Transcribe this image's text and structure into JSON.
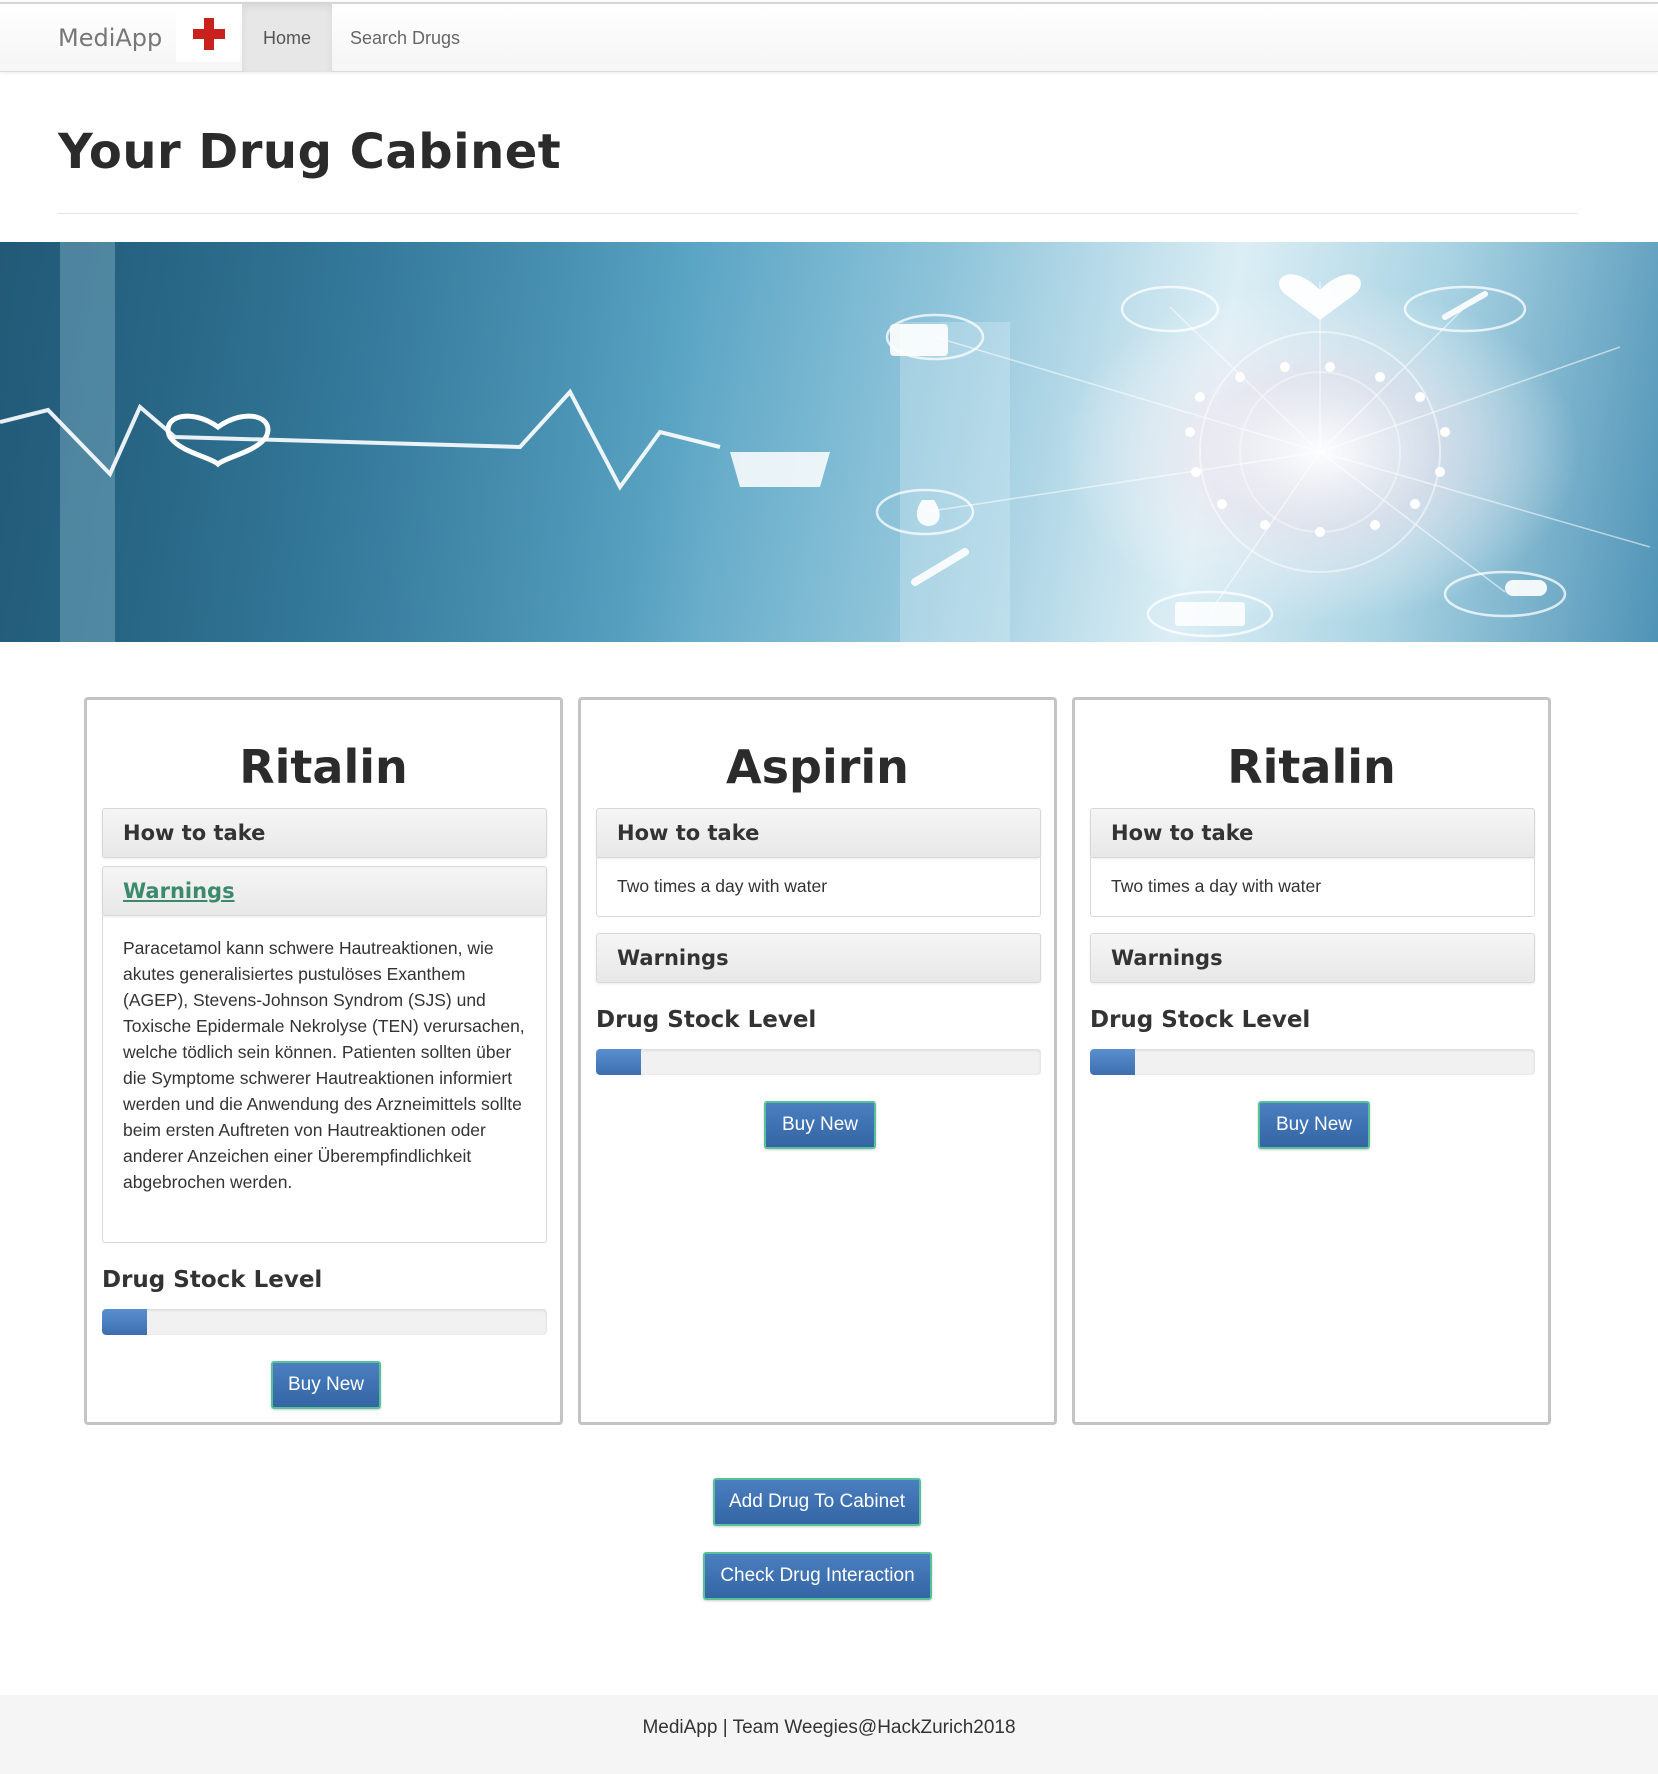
{
  "navbar": {
    "brand": "MediApp",
    "items": [
      {
        "label": "Home",
        "active": true
      },
      {
        "label": "Search Drugs",
        "active": false
      }
    ]
  },
  "page": {
    "title": "Your Drug Cabinet"
  },
  "cards": [
    {
      "name": "Ritalin",
      "how_to_take_label": "How to take",
      "how_to_take_text": "",
      "how_to_take_expanded": false,
      "warnings_label": "Warnings",
      "warnings_expanded": true,
      "warnings_text": "Paracetamol kann schwere Hautreaktionen, wie akutes generalisiertes pustulöses Exanthem (AGEP), Stevens-Johnson Syndrom (SJS) und Toxische Epidermale Nekrolyse (TEN) verursachen, welche tödlich sein können. Patienten sollten über die Symptome schwerer Hautreaktionen informiert werden und die Anwendung des Arzneimittels sollte beim ersten Auftreten von Hautreaktionen oder anderer Anzeichen einer Überempfindlichkeit abgebrochen werden.",
      "stock_label": "Drug Stock Level",
      "stock_level": 0.1,
      "buy_label": "Buy New"
    },
    {
      "name": "Aspirin",
      "how_to_take_label": "How to take",
      "how_to_take_text": "Two times a day with water",
      "how_to_take_expanded": true,
      "warnings_label": "Warnings",
      "warnings_expanded": false,
      "warnings_text": "",
      "stock_label": "Drug Stock Level",
      "stock_level": 0.1,
      "buy_label": "Buy New"
    },
    {
      "name": "Ritalin",
      "how_to_take_label": "How to take",
      "how_to_take_text": "Two times a day with water",
      "how_to_take_expanded": true,
      "warnings_label": "Warnings",
      "warnings_expanded": false,
      "warnings_text": "",
      "stock_label": "Drug Stock Level",
      "stock_level": 0.1,
      "buy_label": "Buy New"
    }
  ],
  "actions": {
    "add_drug": "Add Drug To Cabinet",
    "check_interaction": "Check Drug Interaction"
  },
  "footer": {
    "text": "MediApp | Team Weegies@HackZurich2018"
  },
  "colors": {
    "brand_cross": "#c9211e",
    "button_bg": "#3d72b4",
    "button_border": "#57c29a",
    "progress_fill": "#4a7fc0",
    "warnings_link": "#3b8a6e"
  },
  "icons": [
    "red-cross-icon",
    "heart-icon",
    "pulse-line-icon",
    "medical-network-icons"
  ]
}
